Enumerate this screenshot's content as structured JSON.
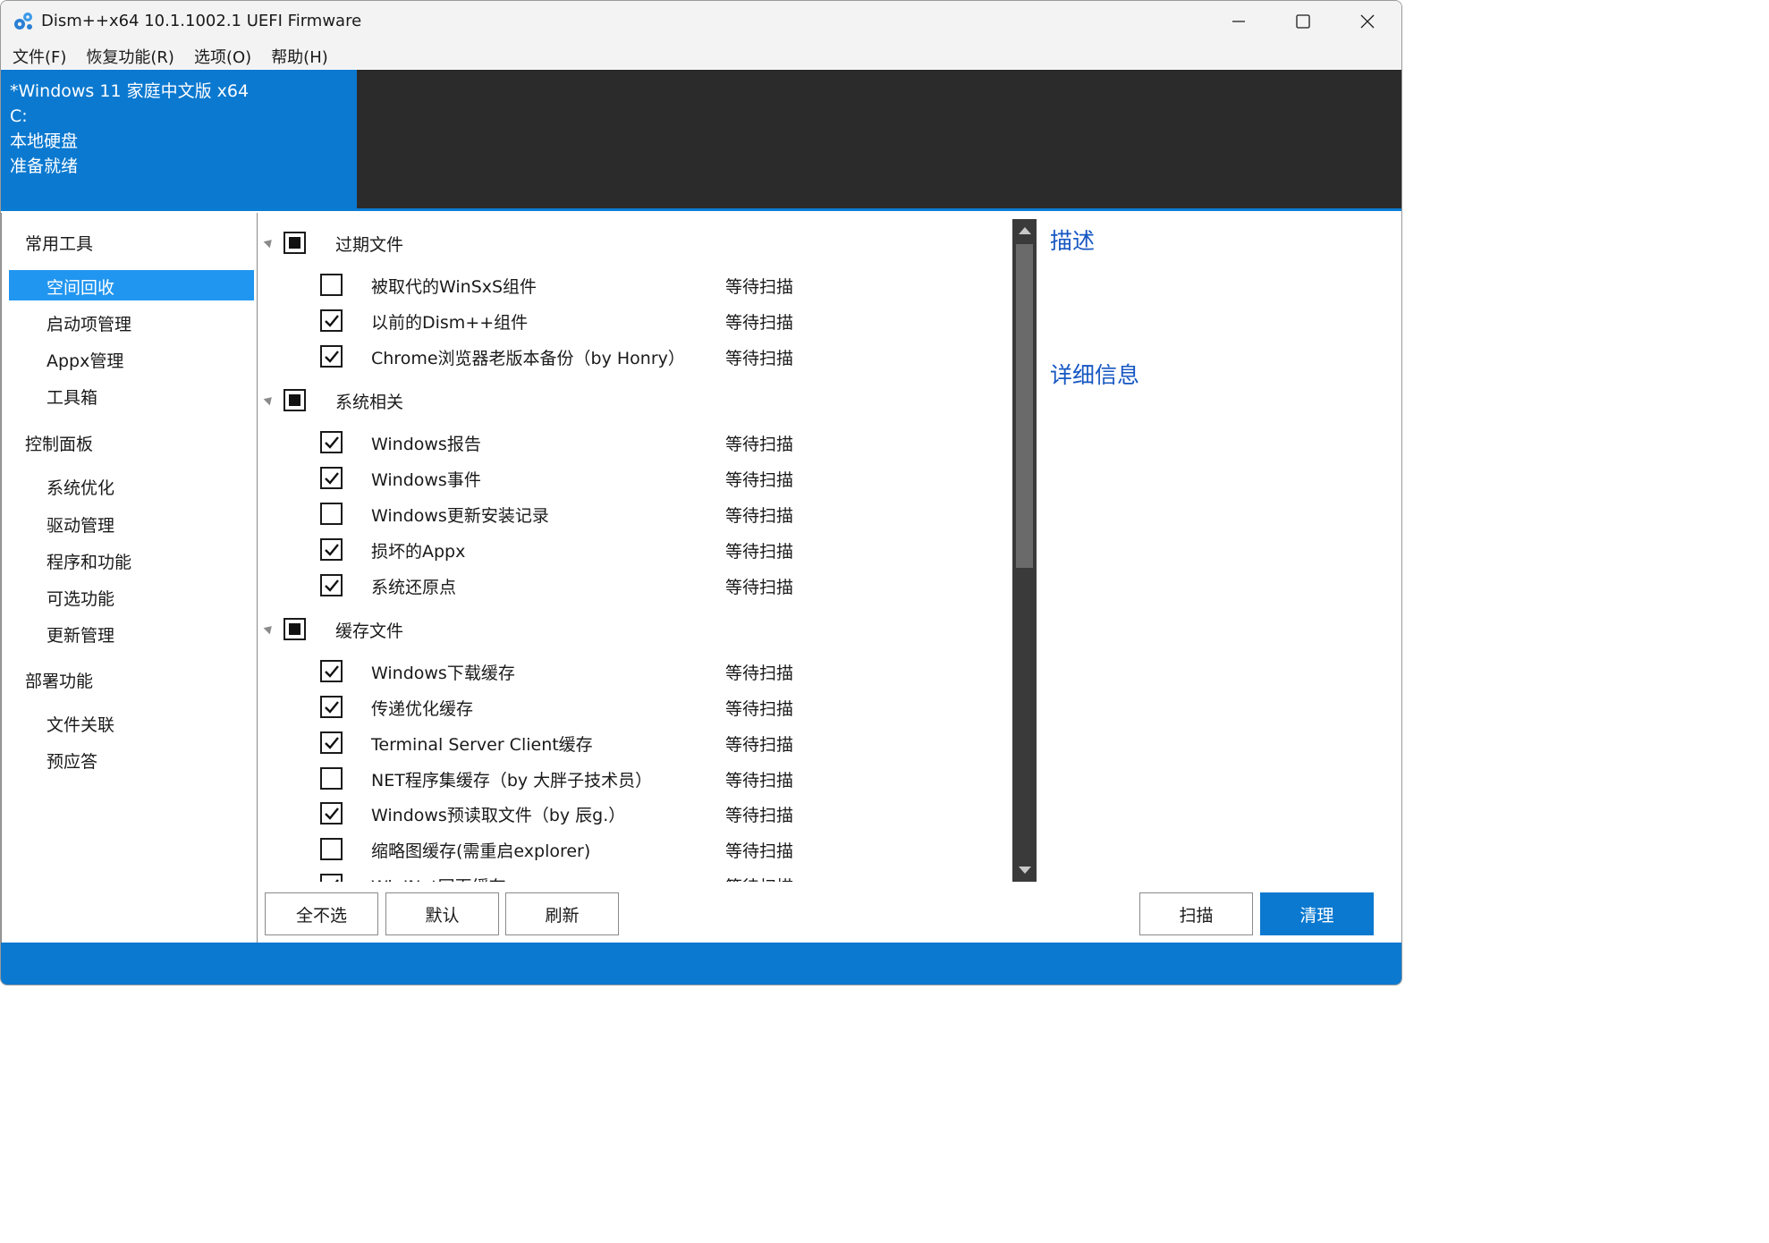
{
  "window": {
    "title": "Dism++x64 10.1.1002.1 UEFI Firmware"
  },
  "menu": {
    "items": [
      "文件(F)",
      "恢复功能(R)",
      "选项(O)",
      "帮助(H)"
    ]
  },
  "image_card": {
    "name": "*Windows 11 家庭中文版 x64",
    "drive": "C:",
    "disk_type": "本地硬盘",
    "status": "准备就绪"
  },
  "sidebar": {
    "groups": [
      {
        "label": "常用工具",
        "items": [
          "空间回收",
          "启动项管理",
          "Appx管理",
          "工具箱"
        ]
      },
      {
        "label": "控制面板",
        "items": [
          "系统优化",
          "驱动管理",
          "程序和功能",
          "可选功能",
          "更新管理"
        ]
      },
      {
        "label": "部署功能",
        "items": [
          "文件关联",
          "预应答"
        ]
      }
    ],
    "selected": "空间回收"
  },
  "cleanup": {
    "categories": [
      {
        "label": "过期文件",
        "items": [
          {
            "label": "被取代的WinSxS组件",
            "checked": false,
            "status": "等待扫描"
          },
          {
            "label": "以前的Dism++组件",
            "checked": true,
            "status": "等待扫描"
          },
          {
            "label": "Chrome浏览器老版本备份（by Honry）",
            "checked": true,
            "status": "等待扫描"
          }
        ]
      },
      {
        "label": "系统相关",
        "items": [
          {
            "label": "Windows报告",
            "checked": true,
            "status": "等待扫描"
          },
          {
            "label": "Windows事件",
            "checked": true,
            "status": "等待扫描"
          },
          {
            "label": "Windows更新安装记录",
            "checked": false,
            "status": "等待扫描"
          },
          {
            "label": "损坏的Appx",
            "checked": true,
            "status": "等待扫描"
          },
          {
            "label": "系统还原点",
            "checked": true,
            "status": "等待扫描"
          }
        ]
      },
      {
        "label": "缓存文件",
        "items": [
          {
            "label": "Windows下载缓存",
            "checked": true,
            "status": "等待扫描"
          },
          {
            "label": "传递优化缓存",
            "checked": true,
            "status": "等待扫描"
          },
          {
            "label": "Terminal Server Client缓存",
            "checked": true,
            "status": "等待扫描"
          },
          {
            "label": "NET程序集缓存（by 大胖子技术员）",
            "checked": false,
            "status": "等待扫描"
          },
          {
            "label": "Windows预读取文件（by 辰g.）",
            "checked": true,
            "status": "等待扫描"
          },
          {
            "label": "缩略图缓存(需重启explorer)",
            "checked": false,
            "status": "等待扫描"
          },
          {
            "label": "WinINet网页缓存",
            "checked": true,
            "status": "等待扫描"
          }
        ]
      }
    ]
  },
  "description": {
    "title": "描述",
    "details_title": "详细信息"
  },
  "buttons": {
    "select_none": "全不选",
    "default": "默认",
    "refresh": "刷新",
    "scan": "扫描",
    "clean": "清理"
  },
  "colors": {
    "accent": "#0b79d0",
    "selection": "#2196f0",
    "header_dark": "#2b2b2b",
    "link_blue": "#1657c2"
  }
}
